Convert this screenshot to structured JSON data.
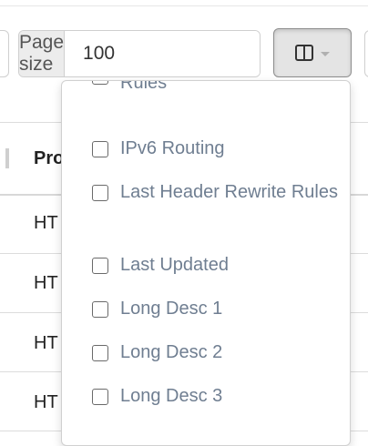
{
  "toolbar": {
    "page_size_label": "Page size",
    "page_size_value": "100",
    "columns_button_icon": "columns-icon"
  },
  "table": {
    "header": "Pro",
    "rows": [
      "HT",
      "HT",
      "HT",
      "HT"
    ]
  },
  "column_menu": {
    "items": [
      {
        "label": "Rules",
        "checked": false
      },
      {
        "label": "IPv6 Routing",
        "checked": false
      },
      {
        "label": "Last Header Rewrite Rules",
        "checked": false
      },
      {
        "label": "Last Updated",
        "checked": false
      },
      {
        "label": "Long Desc 1",
        "checked": false
      },
      {
        "label": "Long Desc 2",
        "checked": false
      },
      {
        "label": "Long Desc 3",
        "checked": false
      }
    ]
  }
}
